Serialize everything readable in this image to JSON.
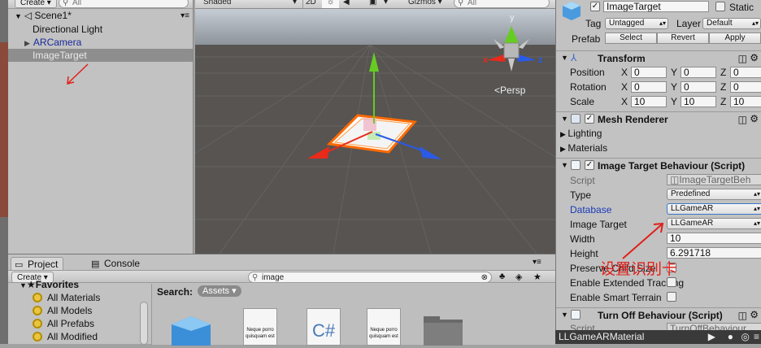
{
  "hierarchy": {
    "create_label": "Create",
    "search_placeholder": "All",
    "scene_name": "Scene1*",
    "items": [
      {
        "label": "Directional Light"
      },
      {
        "label": "ARCamera"
      },
      {
        "label": "ImageTarget"
      }
    ]
  },
  "scene_view": {
    "shading_mode": "Shaded",
    "mode_2d": "2D",
    "gizmos_label": "Gizmos",
    "search_placeholder": "All",
    "persp_label": "Persp",
    "gizmo_x": "x",
    "gizmo_z": "z",
    "gizmo_y": "y"
  },
  "project": {
    "tab_project": "Project",
    "tab_console": "Console",
    "create_label": "Create",
    "search_value": "image",
    "favorites_label": "Favorites",
    "favorites": [
      "All Materials",
      "All Models",
      "All Prefabs",
      "All Modified"
    ],
    "search_label": "Search:",
    "assets_label": "Assets",
    "doc_text_1": "Neque porro",
    "doc_text_2": "quisquam est"
  },
  "inspector": {
    "object_name": "ImageTarget",
    "static_label": "Static",
    "tag_label": "Tag",
    "tag_value": "Untagged",
    "layer_label": "Layer",
    "layer_value": "Default",
    "prefab_label": "Prefab",
    "select_label": "Select",
    "revert_label": "Revert",
    "apply_label": "Apply",
    "transform": {
      "title": "Transform",
      "position_label": "Position",
      "rotation_label": "Rotation",
      "scale_label": "Scale",
      "x_axis": "X",
      "y_axis": "Y",
      "z_axis": "Z",
      "position": [
        "0",
        "0",
        "0"
      ],
      "rotation": [
        "0",
        "0",
        "0"
      ],
      "scale": [
        "10",
        "10",
        "10"
      ]
    },
    "mesh_renderer": {
      "title": "Mesh Renderer",
      "lighting_label": "Lighting",
      "materials_label": "Materials"
    },
    "image_target_behaviour": {
      "title": "Image Target Behaviour (Script)",
      "script_label": "Script",
      "script_value": "ImageTargetBeh",
      "type_label": "Type",
      "type_value": "Predefined",
      "database_label": "Database",
      "database_value": "LLGameAR",
      "image_target_label": "Image Target",
      "image_target_value": "LLGameAR",
      "width_label": "Width",
      "width_value": "10",
      "height_label": "Height",
      "height_value": "6.291718",
      "preserve_label": "Preserve Child Size",
      "extended_label": "Enable Extended Tracking",
      "smart_terrain_label": "Enable Smart Terrain"
    },
    "turn_off_behaviour": {
      "title": "Turn Off Behaviour (Script)",
      "script_label": "Script",
      "script_value": "TurnOffBehaviour"
    }
  },
  "annotation_text": "设置识别卡",
  "status_bar": {
    "label": "LLGameARMaterial"
  },
  "colors": {
    "accent_blue": "#3a78c8",
    "annotation_red": "#e0201a",
    "selection_gray": "#8e8e8e",
    "gizmo_red": "#e82a1a",
    "gizmo_green": "#66cc22",
    "gizmo_blue": "#2a5ae8"
  }
}
